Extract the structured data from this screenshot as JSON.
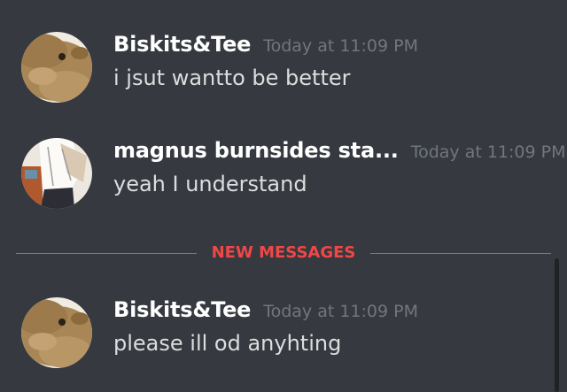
{
  "messages": [
    {
      "username": "Biskits&Tee",
      "timestamp": "Today at 11:09 PM",
      "content": "i jsut wantto be better",
      "avatar": "capybara-avatar"
    },
    {
      "username": "magnus burnsides sta...",
      "timestamp": "Today at 11:09 PM",
      "content": "yeah I understand",
      "avatar": "anime-character-avatar"
    },
    {
      "username": "Biskits&Tee",
      "timestamp": "Today at 11:09 PM",
      "content": "please ill od anyhting",
      "avatar": "capybara-avatar"
    }
  ],
  "divider": {
    "label": "NEW MESSAGES",
    "color": "#f04747"
  },
  "colors": {
    "background": "#36393f",
    "username": "#ffffff",
    "timestamp": "#72767d",
    "message_text": "#dcddde"
  }
}
